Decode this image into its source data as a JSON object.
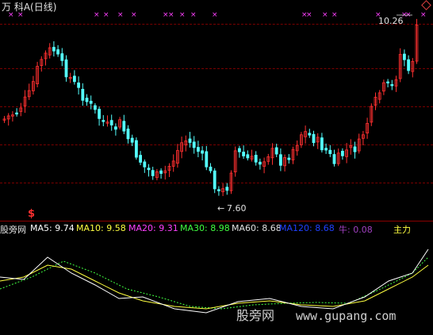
{
  "header": {
    "title": "万 科A(日线)"
  },
  "price_chart": {
    "high_label": "10.26",
    "low_label": "7.60",
    "signal_glyph": "$",
    "marker_glyph": "×",
    "colors": {
      "up": "#ff3030",
      "down": "#54ffff",
      "marker": "#ff40ff"
    }
  },
  "indicator": {
    "name": "股旁网",
    "ma5": "MA5: 9.74",
    "ma10": "MA10: 9.58",
    "ma20": "MA20: 9.31",
    "ma30": "MA30: 8.98",
    "ma60": "MA60: 8.68",
    "ma120": "MA120: 8.68",
    "niu": "牛: 0.08",
    "zhuli": "主力",
    "colors": {
      "ma5": "#ffffff",
      "ma10": "#ffff40",
      "ma20": "#ff40ff",
      "ma30": "#40ff40",
      "ma60": "#e0e0e0",
      "ma120": "#2040ff",
      "niu": "#a040c0",
      "zhuli": "#ffff40"
    }
  },
  "watermark": {
    "cn": "股旁网",
    "url": "www.gupang.com"
  }
}
